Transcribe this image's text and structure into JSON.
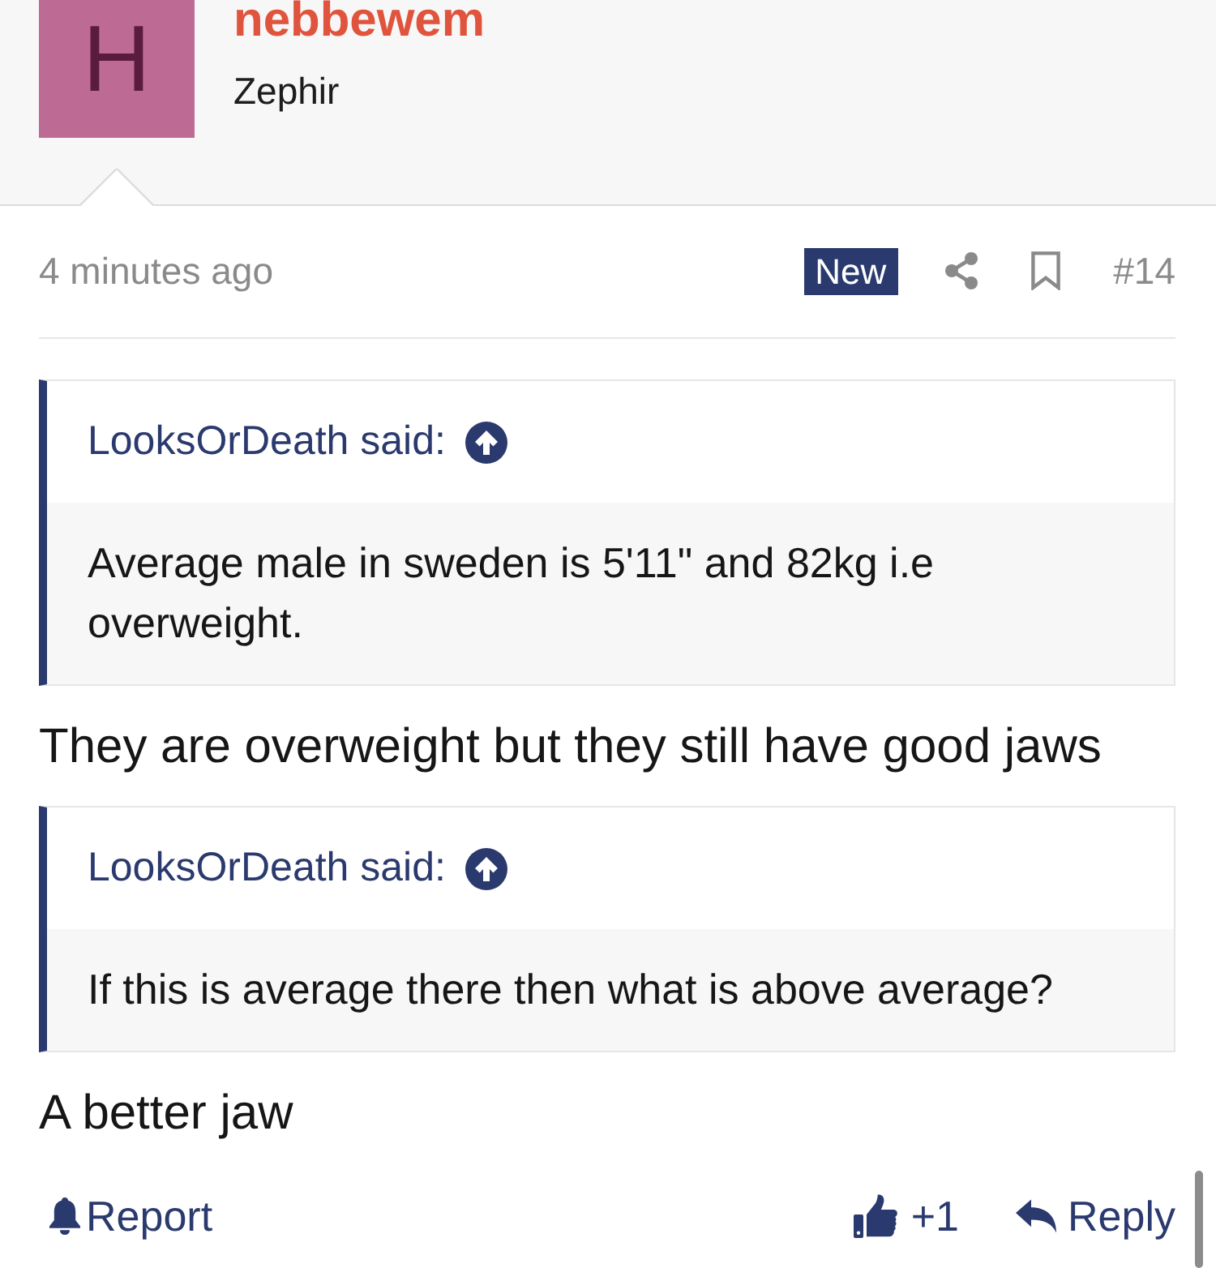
{
  "user": {
    "avatar_letter": "H",
    "username": "nebbewem",
    "user_title": "Zephir"
  },
  "meta": {
    "time": "4 minutes ago",
    "badge": "New",
    "post_number": "#14"
  },
  "content": [
    {
      "kind": "quote",
      "author": "LooksOrDeath said:",
      "text": "Average male in sweden is 5'11\" and 82kg i.e overweight."
    },
    {
      "kind": "paragraph",
      "text": "They are overweight but they still have good jaws"
    },
    {
      "kind": "quote",
      "author": "LooksOrDeath said:",
      "text": "If this is average there then what is above average?"
    },
    {
      "kind": "paragraph",
      "text": "A better jaw"
    }
  ],
  "actions": {
    "report": "Report",
    "like_count": "+1",
    "reply": "Reply"
  }
}
